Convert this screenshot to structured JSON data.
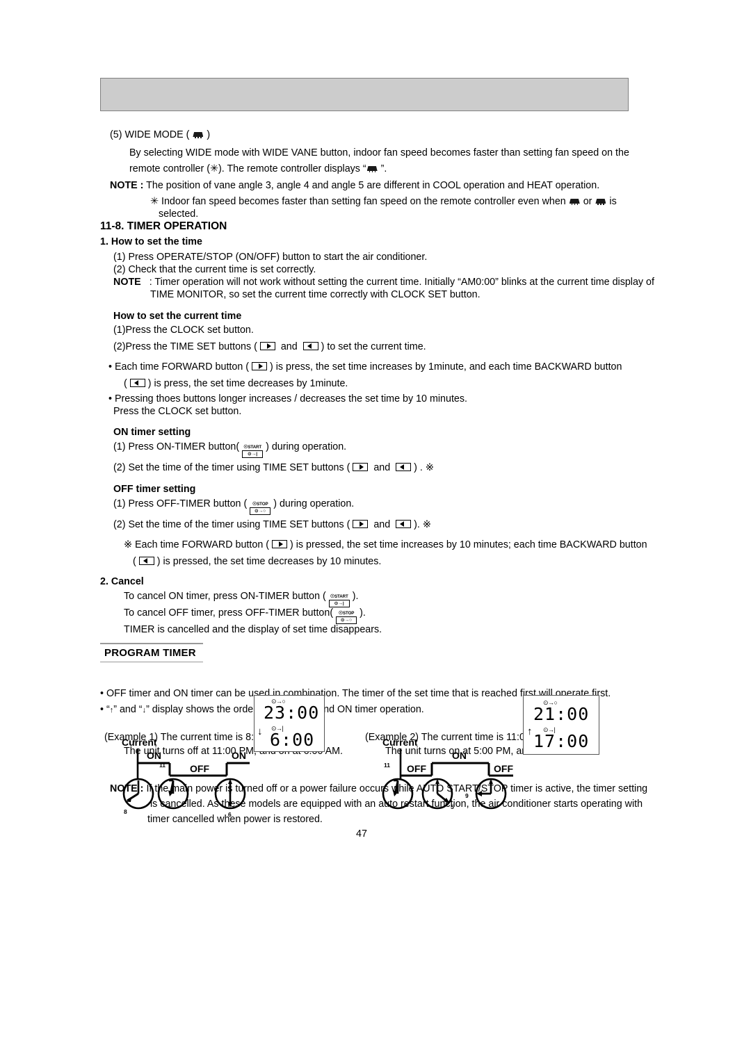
{
  "page": {
    "number": "47"
  },
  "header": {
    "bar_label": ""
  },
  "wide_mode": {
    "title_prefix": "(5) WIDE MODE (",
    "title_suffix": ")",
    "icon": "wide-vane-icon",
    "para1": "By selecting WIDE mode with WIDE VANE button, indoor fan speed becomes faster than setting fan speed on the",
    "para2_pre": "remote controller (",
    "para2_mid": "). The remote controller displays “",
    "para2_post": " ”.",
    "asterisk": "✳",
    "note_label": "NOTE :",
    "note_text": "The position of vane angle 3, angle 4 and angle 5 are different in COOL operation and HEAT operation.",
    "sub_note_pre": "Indoor fan speed becomes faster than setting fan speed on the remote controller even when",
    "sub_note_mid": "or",
    "sub_note_post": "is",
    "sub_note_line2": "selected."
  },
  "timer_operation": {
    "section_number": "11-8.",
    "section_title": "TIMER OPERATION",
    "how_to_set_time_heading": "1. How to set the time",
    "step1": "(1) Press OPERATE/STOP (ON/OFF) button to start the air conditioner.",
    "step2": "(2) Check that the current time is set correctly.",
    "note_label": "NOTE",
    "note_line1": ": Timer operation will not work without setting the current time. Initially “AM0:00” blinks at the current time display of",
    "note_line2": "TIME MONITOR, so set the current time correctly with CLOCK SET button.",
    "current_time_heading": "How to set the current time",
    "ct_step1": "(1)Press the CLOCK set button.",
    "ct_step2_pre": "(2)Press the TIME SET buttons (",
    "ct_step2_and": "and",
    "ct_step2_post": ") to set the current time.",
    "bullet1_pre": "• Each time FORWARD button (",
    "bullet1_post": ") is press, the set time increases by 1minute, and each time BACKWARD button",
    "bullet1_line2_pre": "(",
    "bullet1_line2_post": ") is press, the set time decreases by 1minute.",
    "bullet2_line1": "• Pressing thoes buttons longer increases / decreases the set time by 10 minutes.",
    "bullet2_line2": "Press the CLOCK set button."
  },
  "on_timer": {
    "heading": "ON timer setting",
    "step1_pre": "(1) Press ON-TIMER button(",
    "step1_post": ") during operation.",
    "step2_pre": "(2) Set the time of the timer using TIME SET buttons (",
    "step2_and": "and",
    "step2_post": ") . ※"
  },
  "off_timer": {
    "heading": "OFF timer setting",
    "step1_pre": "(1) Press OFF-TIMER button (",
    "step1_post": ") during operation.",
    "step2_pre": "(2)  Set the time of the timer using TIME SET buttons  (",
    "step2_and": "and",
    "step2_post": "). ※",
    "note_pre": "※  Each time FORWARD button (",
    "note_post": ") is pressed, the set time increases by 10 minutes; each time BACKWARD button",
    "note_line2_pre": "(",
    "note_line2_post": ") is pressed, the set time decreases by 10 minutes."
  },
  "cancel": {
    "heading": "2. Cancel",
    "line1_pre": "To cancel ON timer, press ON-TIMER button (",
    "line1_post": ").",
    "line2_pre": "To cancel OFF timer, press OFF-TIMER button(",
    "line2_post": ").",
    "line3": "TIMER is cancelled and the display of set time disappears."
  },
  "buttons": {
    "forward": {
      "name": "forward-button-icon",
      "glyph": "▶"
    },
    "backward": {
      "name": "backward-button-icon",
      "glyph": "◀"
    },
    "on_timer": {
      "name": "on-timer-button-icon",
      "cap": "START",
      "box": "⊙→|"
    },
    "off_timer": {
      "name": "off-timer-button-icon",
      "cap": "STOP",
      "box": "⊙→○"
    }
  },
  "program_timer": {
    "heading": "PROGRAM TIMER",
    "bullet1": "• OFF timer and ON timer can be used in combination. The timer of the set time that is reached first will operate first.",
    "bullet2_pre": "• “",
    "bullet2_up": "↑",
    "bullet2_mid": "” and “",
    "bullet2_down": "↓",
    "bullet2_post": "” display shows the order of OFF timer and ON timer operation."
  },
  "example1": {
    "label_line1": "(Example 1) The current time is 8:00 PM.",
    "label_line2": "The unit turns off at 11:00 PM, and on at 6:00 AM.",
    "current_label": "Current",
    "state_first": "ON",
    "state_middle": "OFF",
    "state_last": "ON",
    "clock1_hour": "8",
    "clock2_hour": "11",
    "clock3_hour": "6",
    "lcd_top_time": "23:00",
    "lcd_bottom_time": "6:00",
    "lcd_top_symbol": "⊙→○",
    "lcd_bottom_symbol": "⊙→|",
    "lcd_arrow": "↓"
  },
  "example2": {
    "label_line1": "(Example 2) The current time is 11:00 AM.",
    "label_line2": "The unit turns on at 5:00 PM, and off at 9:00 PM.",
    "current_label": "Current",
    "state_first": "OFF",
    "state_middle": "ON",
    "state_last": "OFF",
    "clock1_hour": "11",
    "clock2_hour": "5",
    "clock3_hour": "9",
    "lcd_top_time": "21:00",
    "lcd_bottom_time": "17:00",
    "lcd_top_symbol": "⊙→○",
    "lcd_bottom_symbol": "⊙→|",
    "lcd_arrow": "↑"
  },
  "final_note": {
    "label": "NOTE :",
    "line1": "If the main power is turned off or a power failure occurs while AUTO START/STOP timer is active, the timer setting",
    "line2": "is cancelled. As these models are equipped with an auto restart function, the air conditioner starts operating with",
    "line3": "timer cancelled when power is restored."
  }
}
